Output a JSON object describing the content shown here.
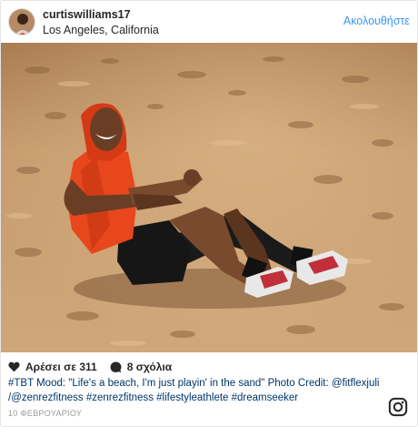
{
  "post": {
    "username": "curtiswilliams17",
    "location": "Los Angeles, California",
    "follow_label": "Ακολουθήστε",
    "likes_label": "Αρέσει σε 311",
    "comments_label": "8 σχόλια",
    "caption": "#TBT Mood: \"Life's a beach, I'm just playin' in the sand\" Photo Credit: @fitflexjuli /@zenrezfitness #zenrezfitness #lifestyleathlete #dreamseeker",
    "date": "10 ΦΕΒΡΟΥΑΡΙΟΥ"
  },
  "icons": {
    "heart": "heart-icon",
    "comment": "comment-bubble-icon",
    "instagram": "instagram-logo-icon"
  },
  "colors": {
    "follow": "#3897f0",
    "caption": "#003569",
    "sand": "#c9a071",
    "hoodie": "#e8461c"
  }
}
